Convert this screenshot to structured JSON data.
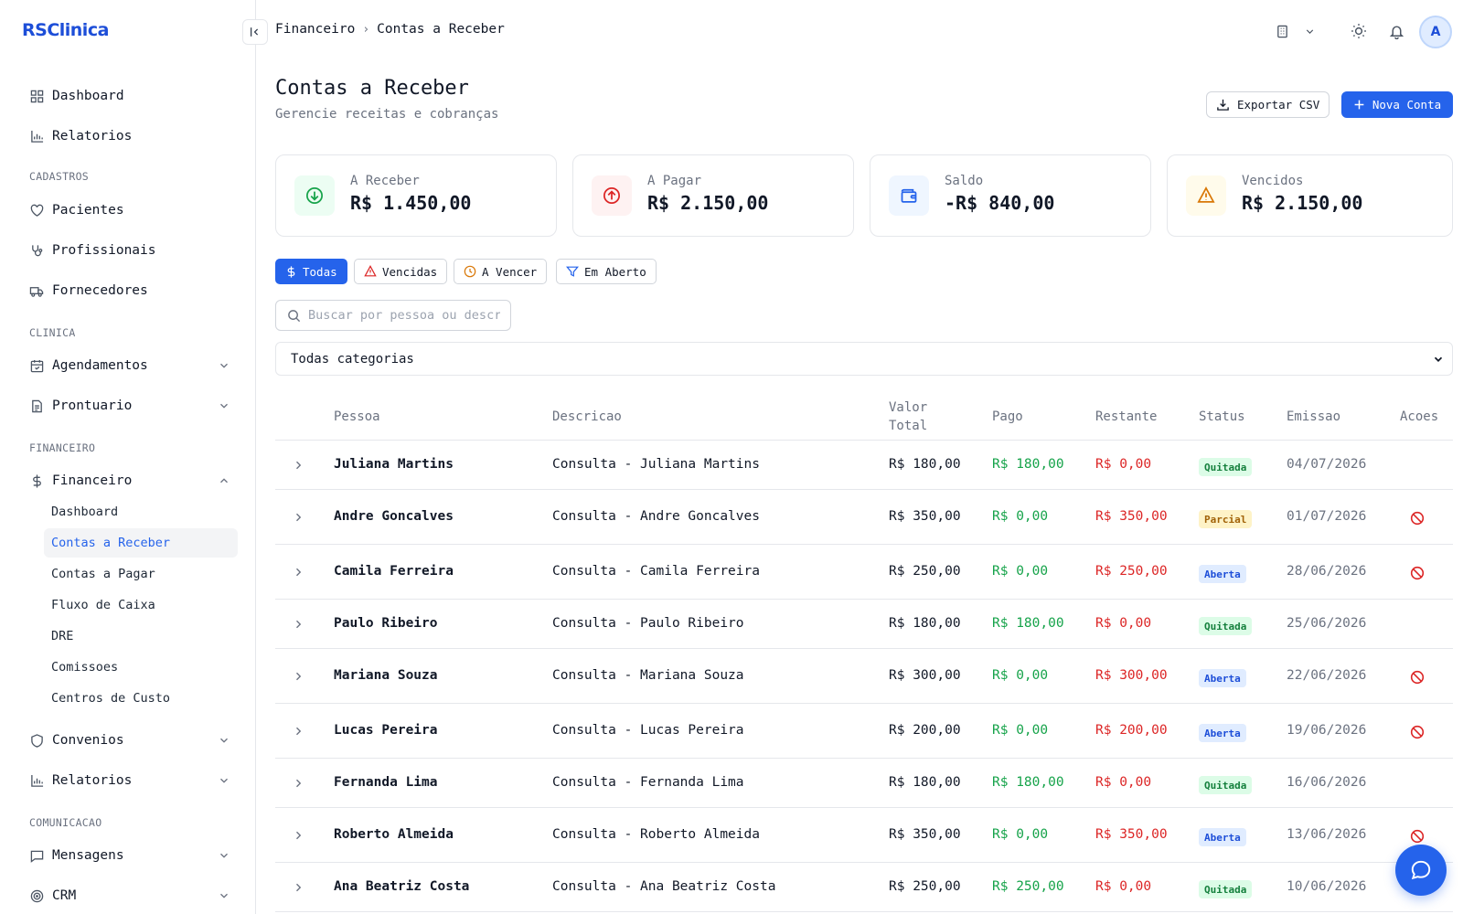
{
  "app": {
    "logo": "RSClinica"
  },
  "sidebar": {
    "top_items": [
      {
        "label": "Dashboard",
        "icon": "grid-icon"
      },
      {
        "label": "Relatorios",
        "icon": "bar-chart-icon"
      }
    ],
    "sections": {
      "cadastros": "CADASTROS",
      "clinica": "CLINICA",
      "financeiro": "FINANCEIRO",
      "comunicacao": "COMUNICACAO"
    },
    "cadastros": [
      {
        "label": "Pacientes",
        "icon": "heart-icon"
      },
      {
        "label": "Profissionais",
        "icon": "stethoscope-icon"
      },
      {
        "label": "Fornecedores",
        "icon": "truck-icon"
      }
    ],
    "clinica": [
      {
        "label": "Agendamentos",
        "icon": "calendar-icon"
      },
      {
        "label": "Prontuario",
        "icon": "file-text-icon"
      }
    ],
    "financeiro": {
      "label": "Financeiro",
      "icon": "dollar-icon"
    },
    "financeiro_sub": [
      "Dashboard",
      "Contas a Receber",
      "Contas a Pagar",
      "Fluxo de Caixa",
      "DRE",
      "Comissoes",
      "Centros de Custo"
    ],
    "more": [
      {
        "label": "Convenios",
        "icon": "shield-icon"
      },
      {
        "label": "Relatorios",
        "icon": "bar-chart-icon"
      }
    ],
    "comunicacao": [
      {
        "label": "Mensagens",
        "icon": "message-square-icon"
      },
      {
        "label": "CRM",
        "icon": "target-icon"
      }
    ]
  },
  "header": {
    "breadcrumb": [
      "Financeiro",
      "Contas a Receber"
    ],
    "user_initial": "A"
  },
  "page": {
    "title": "Contas a Receber",
    "subtitle": "Gerencie receitas e cobranças",
    "export_label": "Exportar CSV",
    "new_label": "Nova Conta"
  },
  "cards": [
    {
      "label": "A Receber",
      "value": "R$ 1.450,00",
      "icon": "arrow-down-circle-icon",
      "color": "#16a34a",
      "bg": "#ecfdf3"
    },
    {
      "label": "A Pagar",
      "value": "R$ 2.150,00",
      "icon": "arrow-up-circle-icon",
      "color": "#dc2626",
      "bg": "#fef2f2"
    },
    {
      "label": "Saldo",
      "value": "-R$ 840,00",
      "icon": "wallet-icon",
      "color": "#2563eb",
      "bg": "#eff6ff"
    },
    {
      "label": "Vencidos",
      "value": "R$ 2.150,00",
      "icon": "alert-triangle-icon",
      "color": "#d97706",
      "bg": "#fffbeb"
    }
  ],
  "filters": [
    {
      "label": "Todas",
      "icon": "dollar-icon",
      "active": true
    },
    {
      "label": "Vencidas",
      "icon": "alert-triangle-icon",
      "active": false
    },
    {
      "label": "A Vencer",
      "icon": "clock-icon",
      "active": false
    },
    {
      "label": "Em Aberto",
      "icon": "filter-icon",
      "active": false
    }
  ],
  "search": {
    "placeholder": "Buscar por pessoa ou descricao"
  },
  "category_select": {
    "value": "Todas categorias"
  },
  "table": {
    "columns": [
      "Pessoa",
      "Descricao",
      "Valor Total",
      "Pago",
      "Restante",
      "Status",
      "Emissao",
      "Acoes"
    ],
    "rows": [
      {
        "pessoa": "Juliana Martins",
        "descricao": "Consulta - Juliana Martins",
        "valor": "R$ 180,00",
        "pago": "R$ 180,00",
        "restante": "R$ 0,00",
        "status": "Quitada",
        "emissao": "04/07/2026",
        "cancel": false
      },
      {
        "pessoa": "Andre Goncalves",
        "descricao": "Consulta - Andre Goncalves",
        "valor": "R$ 350,00",
        "pago": "R$ 0,00",
        "restante": "R$ 350,00",
        "status": "Parcial",
        "emissao": "01/07/2026",
        "cancel": true
      },
      {
        "pessoa": "Camila Ferreira",
        "descricao": "Consulta - Camila Ferreira",
        "valor": "R$ 250,00",
        "pago": "R$ 0,00",
        "restante": "R$ 250,00",
        "status": "Aberta",
        "emissao": "28/06/2026",
        "cancel": true
      },
      {
        "pessoa": "Paulo Ribeiro",
        "descricao": "Consulta - Paulo Ribeiro",
        "valor": "R$ 180,00",
        "pago": "R$ 180,00",
        "restante": "R$ 0,00",
        "status": "Quitada",
        "emissao": "25/06/2026",
        "cancel": false
      },
      {
        "pessoa": "Mariana Souza",
        "descricao": "Consulta - Mariana Souza",
        "valor": "R$ 300,00",
        "pago": "R$ 0,00",
        "restante": "R$ 300,00",
        "status": "Aberta",
        "emissao": "22/06/2026",
        "cancel": true
      },
      {
        "pessoa": "Lucas Pereira",
        "descricao": "Consulta - Lucas Pereira",
        "valor": "R$ 200,00",
        "pago": "R$ 0,00",
        "restante": "R$ 200,00",
        "status": "Aberta",
        "emissao": "19/06/2026",
        "cancel": true
      },
      {
        "pessoa": "Fernanda Lima",
        "descricao": "Consulta - Fernanda Lima",
        "valor": "R$ 180,00",
        "pago": "R$ 180,00",
        "restante": "R$ 0,00",
        "status": "Quitada",
        "emissao": "16/06/2026",
        "cancel": false
      },
      {
        "pessoa": "Roberto Almeida",
        "descricao": "Consulta - Roberto Almeida",
        "valor": "R$ 350,00",
        "pago": "R$ 0,00",
        "restante": "R$ 350,00",
        "status": "Aberta",
        "emissao": "13/06/2026",
        "cancel": true
      },
      {
        "pessoa": "Ana Beatriz Costa",
        "descricao": "Consulta - Ana Beatriz Costa",
        "valor": "R$ 250,00",
        "pago": "R$ 250,00",
        "restante": "R$ 0,00",
        "status": "Quitada",
        "emissao": "10/06/2026",
        "cancel": false
      }
    ]
  },
  "colors": {
    "accent": "#2563eb",
    "positive": "#16a34a",
    "negative": "#dc2626"
  }
}
